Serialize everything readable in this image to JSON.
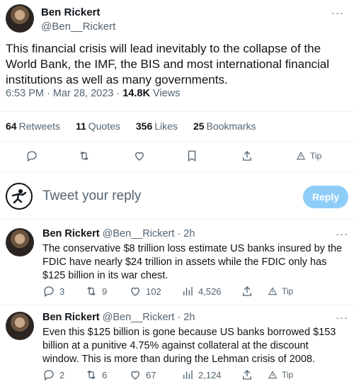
{
  "main_tweet": {
    "author_name": "Ben Rickert",
    "author_handle": "@Ben__Rickert",
    "more_label": "···",
    "text": "This financial crisis will lead inevitably to the collapse of the World Bank, the IMF, the BIS and most international financial institutions as well as many governments.",
    "time": "6:53 PM",
    "date": "Mar 28, 2023",
    "views_count": "14.8K",
    "views_label": "Views",
    "stats": {
      "retweets_count": "64",
      "retweets_label": "Retweets",
      "quotes_count": "11",
      "quotes_label": "Quotes",
      "likes_count": "356",
      "likes_label": "Likes",
      "bookmarks_count": "25",
      "bookmarks_label": "Bookmarks"
    },
    "actions": {
      "icons": [
        "reply-icon",
        "retweet-icon",
        "like-icon",
        "bookmark-icon",
        "share-icon",
        "tip-icon"
      ],
      "tip_label": "Tip"
    }
  },
  "composer": {
    "placeholder": "Tweet your reply",
    "button_label": "Reply",
    "button_color": "#8ecdf8"
  },
  "replies": [
    {
      "author_name": "Ben Rickert",
      "author_handle": "@Ben__Rickert",
      "age": "· 2h",
      "text": "The conservative $8 trillion loss estimate US banks insured by the FDIC have nearly $24 trillion in assets while the FDIC only has $125 billion in its war chest.",
      "replies": "3",
      "retweets": "9",
      "likes": "102",
      "views": "4,526",
      "tip_label": "Tip"
    },
    {
      "author_name": "Ben Rickert",
      "author_handle": "@Ben__Rickert",
      "age": "· 2h",
      "text": "Even this $125 billion is gone because US banks borrowed $153 billion at a punitive 4.75% against collateral at the discount window. This is more than during the Lehman crisis of 2008.",
      "replies": "2",
      "retweets": "6",
      "likes": "67",
      "views": "2,124",
      "tip_label": "Tip"
    }
  ],
  "colors": {
    "text": "#0f1419",
    "muted": "#536471",
    "divider": "#eff3f4"
  }
}
